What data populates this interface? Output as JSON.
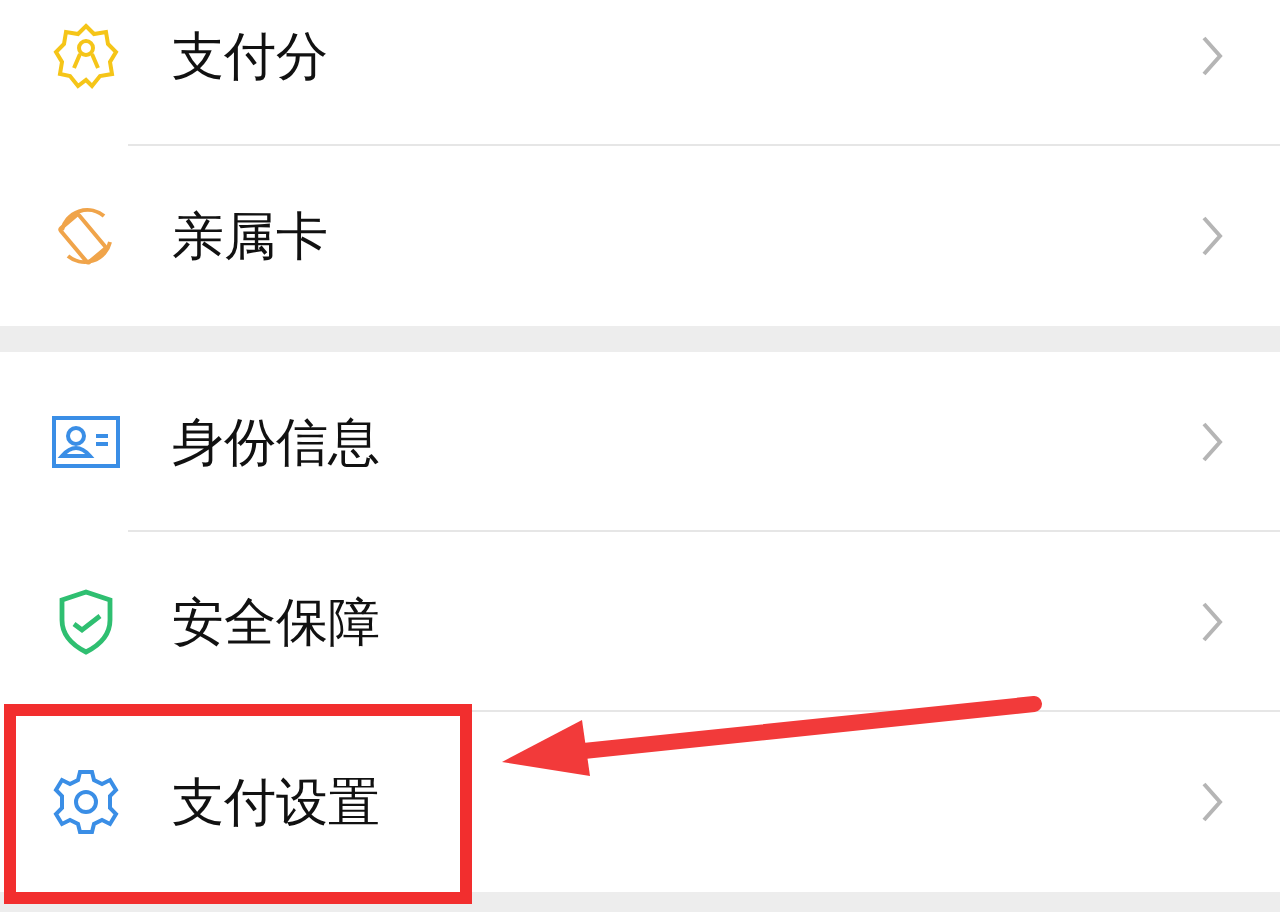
{
  "groups": [
    {
      "items": [
        {
          "label": "支付分",
          "kind": "badge",
          "highlighted": false
        },
        {
          "label": "亲属卡",
          "kind": "card",
          "highlighted": false
        }
      ]
    },
    {
      "items": [
        {
          "label": "身份信息",
          "kind": "id",
          "highlighted": false
        },
        {
          "label": "安全保障",
          "kind": "shield",
          "highlighted": false
        },
        {
          "label": "支付设置",
          "kind": "gear",
          "highlighted": true
        }
      ]
    }
  ]
}
